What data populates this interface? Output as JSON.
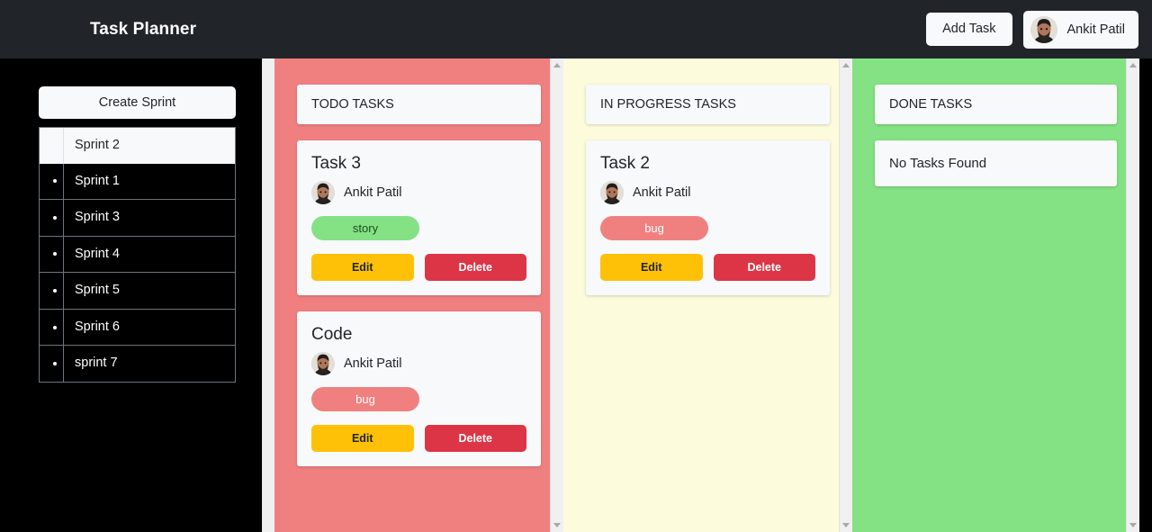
{
  "header": {
    "title": "Task Planner",
    "add_task_label": "Add Task",
    "user_name": "Ankit Patil",
    "bg_color": "#212529"
  },
  "sidebar": {
    "create_sprint_label": "Create Sprint",
    "sprints": [
      {
        "label": "Sprint 2",
        "active": true
      },
      {
        "label": "Sprint 1",
        "active": false
      },
      {
        "label": "Sprint 3",
        "active": false
      },
      {
        "label": "Sprint 4",
        "active": false
      },
      {
        "label": "Sprint 5",
        "active": false
      },
      {
        "label": "Sprint 6",
        "active": false
      },
      {
        "label": "sprint 7",
        "active": false
      }
    ]
  },
  "board": {
    "columns": [
      {
        "header": "TODO TASKS",
        "bg_color": "#f08080",
        "empty_text": null,
        "tasks": [
          {
            "title": "Task 3",
            "assignee": "Ankit Patil",
            "tag": "story",
            "tag_color": "#84e184",
            "edit_label": "Edit",
            "delete_label": "Delete"
          },
          {
            "title": "Code",
            "assignee": "Ankit Patil",
            "tag": "bug",
            "tag_color": "#f08080",
            "edit_label": "Edit",
            "delete_label": "Delete"
          }
        ]
      },
      {
        "header": "IN PROGRESS TASKS",
        "bg_color": "#fcfbdc",
        "empty_text": null,
        "tasks": [
          {
            "title": "Task 2",
            "assignee": "Ankit Patil",
            "tag": "bug",
            "tag_color": "#f08080",
            "edit_label": "Edit",
            "delete_label": "Delete"
          }
        ]
      },
      {
        "header": "DONE TASKS",
        "bg_color": "#84e184",
        "empty_text": "No Tasks Found",
        "tasks": []
      }
    ]
  },
  "colors": {
    "edit_button": "#ffc107",
    "delete_button": "#dc3545",
    "card_bg": "#f8f9fa",
    "sidebar_bg": "#000000"
  }
}
